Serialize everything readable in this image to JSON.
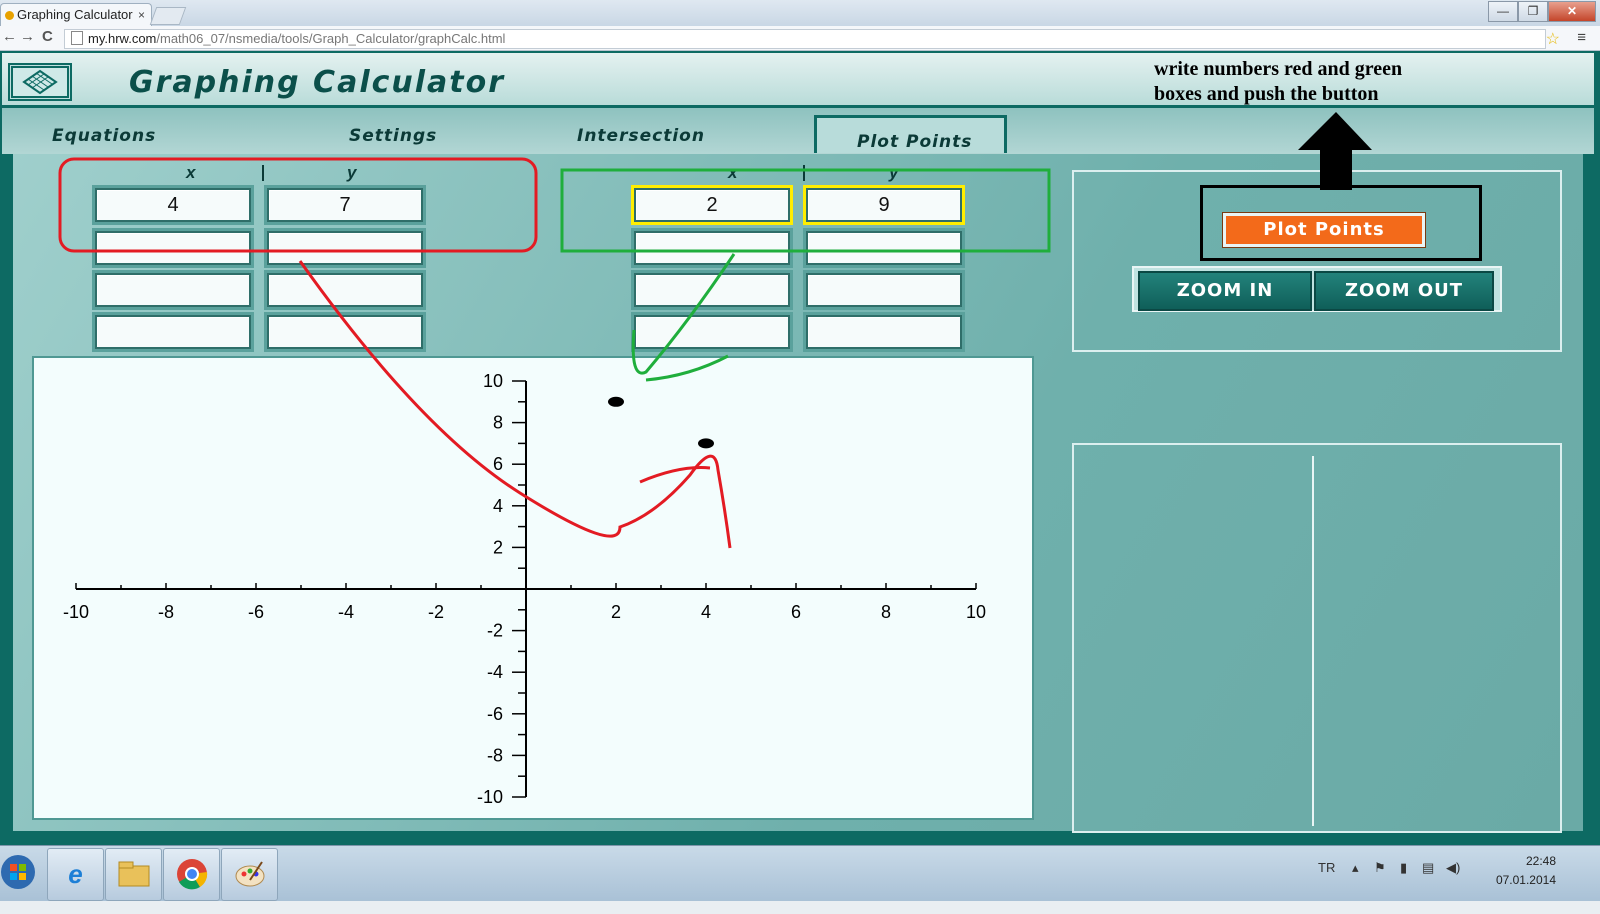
{
  "browser": {
    "tab_title": "Graphing Calculator",
    "tab_close": "×",
    "url_domain": "my.hrw.com",
    "url_path": "/math06_07/nsmedia/tools/Graph_Calculator/graphCalc.html",
    "nav_back": "←",
    "nav_forward": "→",
    "nav_reload": "C",
    "star_icon": "☆",
    "menu_icon": "≡",
    "win_min": "—",
    "win_max": "❐",
    "win_close": "✕"
  },
  "app": {
    "title": "Graphing Calculator",
    "note_line1": "write numbers red and green",
    "note_line2": "boxes and push the button",
    "tabs": [
      {
        "label": "Equations"
      },
      {
        "label": "Settings"
      },
      {
        "label": "Intersection"
      },
      {
        "label": "Plot Points"
      }
    ],
    "active_tab": "Plot Points",
    "left_table": {
      "x_header": "x",
      "y_header": "y",
      "rows": [
        {
          "x": "4",
          "y": "7"
        },
        {
          "x": "",
          "y": ""
        },
        {
          "x": "",
          "y": ""
        },
        {
          "x": "",
          "y": ""
        }
      ]
    },
    "right_table": {
      "x_header": "x",
      "y_header": "y",
      "rows": [
        {
          "x": "2",
          "y": "9"
        },
        {
          "x": "",
          "y": ""
        },
        {
          "x": "",
          "y": ""
        },
        {
          "x": "",
          "y": ""
        }
      ]
    },
    "plot_points_button": "Plot Points",
    "zoom_in_button": "ZOOM IN",
    "zoom_out_button": "ZOOM OUT",
    "colors": {
      "annotation_red": "#e31b23",
      "annotation_green": "#1fae3c",
      "plot_button": "#f36a1a",
      "highlight_yellow": "#ffee00",
      "app_teal": "#0d6a63"
    }
  },
  "chart_data": {
    "type": "scatter",
    "xlim": [
      -10,
      10
    ],
    "ylim": [
      -10,
      10
    ],
    "x_ticks": [
      -10,
      -8,
      -6,
      -4,
      -2,
      2,
      4,
      6,
      8,
      10
    ],
    "y_ticks": [
      10,
      8,
      6,
      4,
      2,
      -2,
      -4,
      -6,
      -8,
      -10
    ],
    "points": [
      {
        "x": 2,
        "y": 9
      },
      {
        "x": 4,
        "y": 7
      }
    ]
  },
  "taskbar": {
    "language": "TR",
    "time": "22:48",
    "date": "07.01.2014",
    "apps": [
      "windows-start-icon",
      "internet-explorer-icon",
      "file-explorer-icon",
      "chrome-icon",
      "paint-icon"
    ]
  }
}
